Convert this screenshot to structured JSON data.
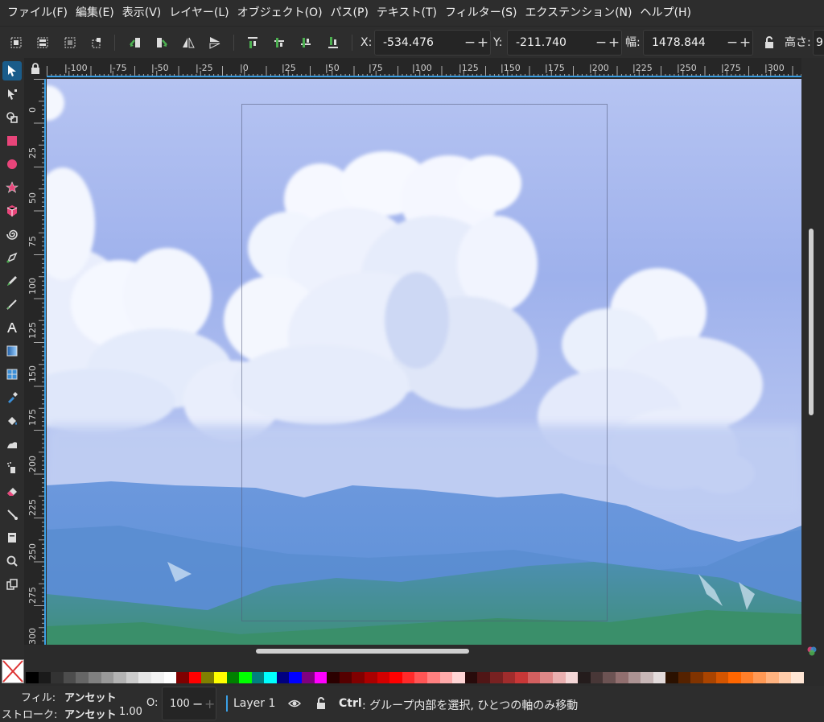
{
  "menu": [
    "ファイル(F)",
    "編集(E)",
    "表示(V)",
    "レイヤー(L)",
    "オブジェクト(O)",
    "パス(P)",
    "テキスト(T)",
    "フィルター(S)",
    "エクステンション(N)",
    "ヘルプ(H)"
  ],
  "toolbar": {
    "x_label": "X:",
    "x_value": "-534.476",
    "y_label": "Y:",
    "y_value": "-211.740",
    "w_label": "幅:",
    "w_value": "1478.844",
    "h_label": "高さ:",
    "h_value": "9",
    "minus": "−",
    "plus": "+"
  },
  "ruler": {
    "h_labels": [
      "|-100",
      "|-75",
      "|-50",
      "|-25",
      "|0",
      "|25",
      "|50",
      "|75",
      "|100",
      "|125",
      "|150",
      "|175",
      "|200",
      "|225",
      "|250",
      "|275",
      "|300"
    ],
    "v_labels": [
      "0",
      "25",
      "50",
      "75",
      "100",
      "125",
      "150",
      "175",
      "200",
      "225",
      "250",
      "275",
      "300"
    ]
  },
  "palette": {
    "colors": [
      "#000000",
      "#1a1a1a",
      "#333333",
      "#4d4d4d",
      "#666666",
      "#808080",
      "#999999",
      "#b3b3b3",
      "#cccccc",
      "#e6e6e6",
      "#f2f2f2",
      "#ffffff",
      "#800000",
      "#ff0000",
      "#808000",
      "#ffff00",
      "#008000",
      "#00ff00",
      "#008080",
      "#00ffff",
      "#000080",
      "#0000ff",
      "#800080",
      "#ff00ff",
      "#2b0000",
      "#550000",
      "#800000",
      "#aa0000",
      "#d40000",
      "#ff0000",
      "#ff2a2a",
      "#ff5555",
      "#ff8080",
      "#ffaaaa",
      "#ffd5d5",
      "#280b0b",
      "#501616",
      "#782121",
      "#a02c2c",
      "#c83737",
      "#d35f5f",
      "#de8787",
      "#e9afaf",
      "#f4d7d7",
      "#241c1c",
      "#483737",
      "#6c5353",
      "#916f6f",
      "#ac9393",
      "#c8b7b7",
      "#e3dbdb",
      "#2b1100",
      "#552200",
      "#803300",
      "#aa4400",
      "#d45500",
      "#ff6600",
      "#ff7f2a",
      "#ff9955",
      "#ffb380",
      "#ffccaa",
      "#ffe6d5"
    ]
  },
  "status": {
    "fill_label": "フィル:",
    "fill_value": "アンセット",
    "stroke_label": "ストローク:",
    "stroke_value": "アンセット",
    "stroke_width": "1.00",
    "opacity_label": "O:",
    "opacity_value": "100",
    "layer_name": "Layer 1",
    "hint_key": "Ctrl",
    "hint_text": ": グループ内部を選択, ひとつの軸のみ移動"
  }
}
